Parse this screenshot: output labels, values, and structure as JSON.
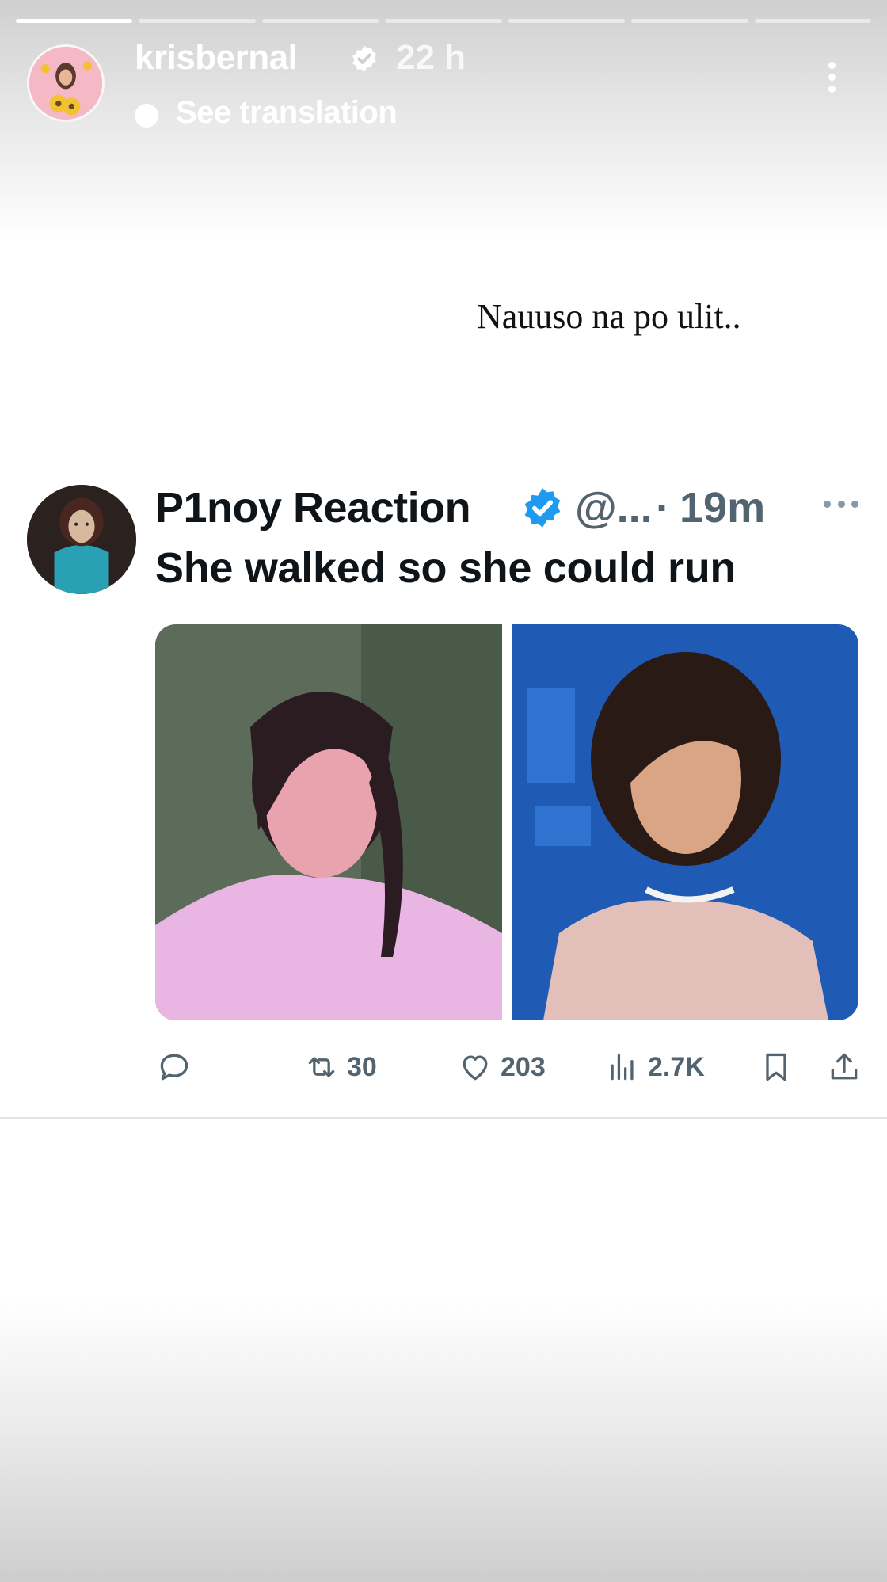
{
  "story": {
    "progress_segments": [
      1.0,
      0.0,
      0.0,
      0.0,
      0.0,
      0.0,
      0.0
    ],
    "username": "krisbernal",
    "time_ago": "22 h",
    "translate_label": "See translation",
    "caption": "Nauuso na po ulit.."
  },
  "tweet": {
    "display_name": "P1noy Reaction",
    "handle": "@...",
    "separator": "·",
    "time_ago": "19m",
    "text": "She walked so she could run",
    "actions": {
      "retweets": "30",
      "likes": "203",
      "views": "2.7K"
    }
  },
  "colors": {
    "tweet_verified": "#1d9bf0",
    "secondary_text": "#536471",
    "primary_text": "#0f1419"
  },
  "icons": [
    "verified-badge-icon",
    "translate-icon",
    "more-vertical-icon",
    "more-horizontal-icon",
    "reply-icon",
    "retweet-icon",
    "like-icon",
    "views-icon",
    "bookmark-icon",
    "share-icon"
  ]
}
